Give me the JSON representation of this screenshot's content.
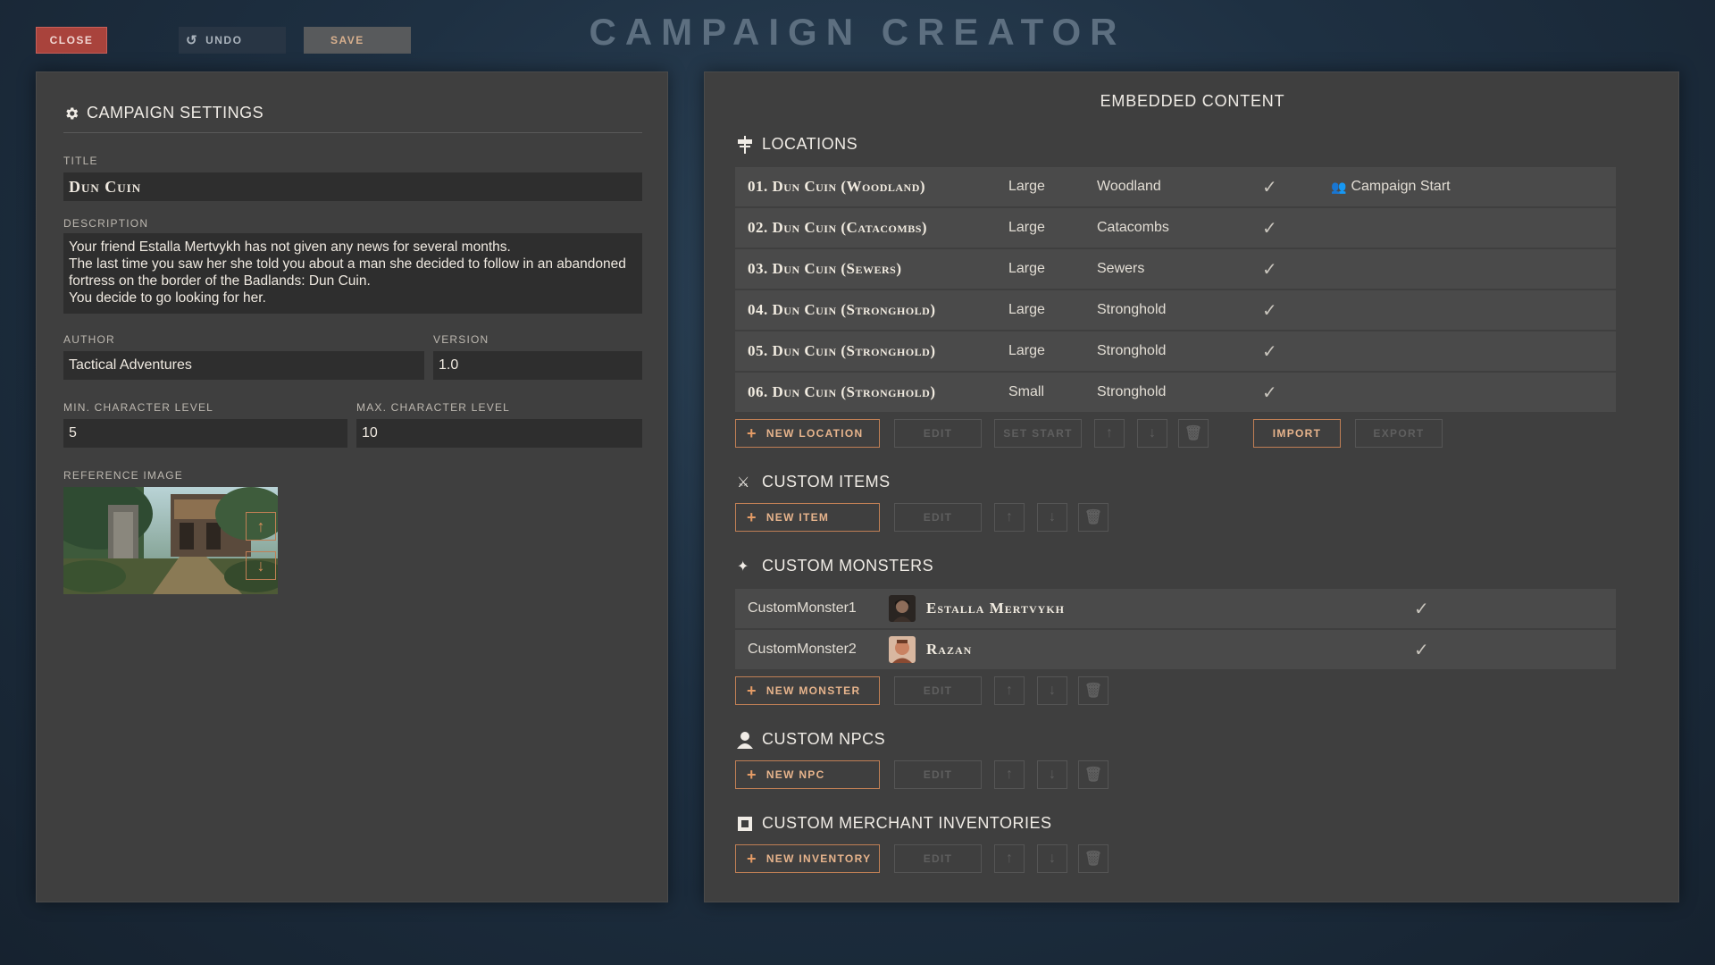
{
  "app": {
    "title": "CAMPAIGN CREATOR"
  },
  "toolbar": {
    "close_label": "CLOSE",
    "undo_label": "UNDO",
    "save_label": "SAVE"
  },
  "settings": {
    "header": "CAMPAIGN SETTINGS",
    "title_label": "TITLE",
    "title_value": "Dun Cuin",
    "description_label": "DESCRIPTION",
    "description_lines": [
      "Your friend Estalla Mertvykh has not given any news for several months.",
      "The last time you saw her she told you about a man she decided to follow in an abandoned fortress on the border of the Badlands: Dun Cuin.",
      "You decide to go looking for her."
    ],
    "author_label": "AUTHOR",
    "author_value": "Tactical Adventures",
    "version_label": "VERSION",
    "version_value": "1.0",
    "min_level_label": "MIN. CHARACTER LEVEL",
    "min_level_value": "5",
    "max_level_label": "MAX. CHARACTER LEVEL",
    "max_level_value": "10",
    "reference_image_label": "REFERENCE IMAGE"
  },
  "embedded": {
    "header": "EMBEDDED CONTENT",
    "locations": {
      "title": "LOCATIONS",
      "rows": [
        {
          "name": "01. Dun Cuin (Woodland)",
          "size": "Large",
          "environment": "Woodland",
          "extra": "Campaign Start"
        },
        {
          "name": "02. Dun Cuin (Catacombs)",
          "size": "Large",
          "environment": "Catacombs",
          "extra": ""
        },
        {
          "name": "03. Dun Cuin (Sewers)",
          "size": "Large",
          "environment": "Sewers",
          "extra": ""
        },
        {
          "name": "04. Dun Cuin (Stronghold)",
          "size": "Large",
          "environment": "Stronghold",
          "extra": ""
        },
        {
          "name": "05. Dun Cuin (Stronghold)",
          "size": "Large",
          "environment": "Stronghold",
          "extra": ""
        },
        {
          "name": "06. Dun Cuin (Stronghold)",
          "size": "Small",
          "environment": "Stronghold",
          "extra": ""
        }
      ],
      "new_label": "NEW LOCATION",
      "edit_label": "EDIT",
      "set_start_label": "SET START",
      "import_label": "IMPORT",
      "export_label": "EXPORT"
    },
    "items": {
      "title": "CUSTOM ITEMS",
      "new_label": "NEW ITEM",
      "edit_label": "EDIT"
    },
    "monsters": {
      "title": "CUSTOM MONSTERS",
      "rows": [
        {
          "id": "CustomMonster1",
          "name": "Estalla Mertvykh"
        },
        {
          "id": "CustomMonster2",
          "name": "Razan"
        }
      ],
      "new_label": "NEW MONSTER",
      "edit_label": "EDIT"
    },
    "npcs": {
      "title": "CUSTOM NPCS",
      "new_label": "NEW NPC",
      "edit_label": "EDIT"
    },
    "merchants": {
      "title": "CUSTOM MERCHANT INVENTORIES",
      "new_label": "NEW INVENTORY",
      "edit_label": "EDIT"
    }
  },
  "colors": {
    "accent": "#c07f55",
    "close": "#a9433c",
    "panel": "#3f3f3f",
    "row": "#4a4a4a"
  }
}
